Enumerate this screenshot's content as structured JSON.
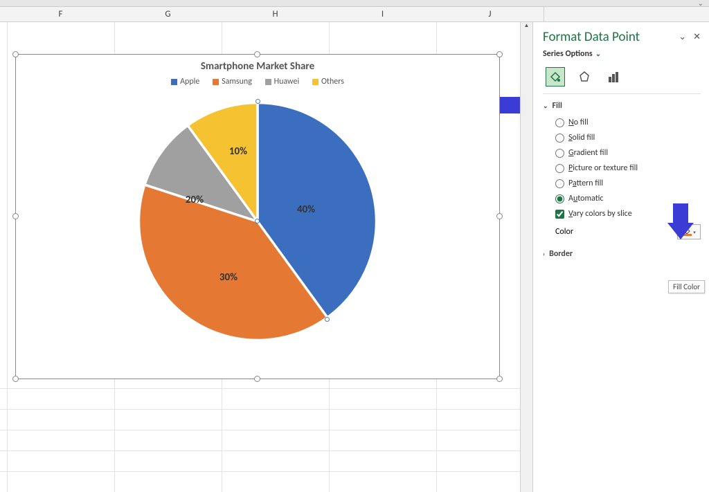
{
  "columns": [
    "F",
    "G",
    "H",
    "I",
    "J"
  ],
  "chart_data": {
    "type": "pie",
    "title": "Smartphone Market Share",
    "categories": [
      "Apple",
      "Samsung",
      "Huawei",
      "Others"
    ],
    "values": [
      40,
      30,
      20,
      10
    ],
    "labels": [
      "40%",
      "30%",
      "20%",
      "10%"
    ],
    "colors": [
      "#3c6ebf",
      "#e57832",
      "#a0a0a0",
      "#f5c231"
    ]
  },
  "pane": {
    "title": "Format Data Point",
    "series_options": "Series Options",
    "sections": {
      "fill": "Fill",
      "border": "Border"
    },
    "fill_options": {
      "no_fill": "No fill",
      "solid_fill": "Solid fill",
      "gradient_fill": "Gradient fill",
      "picture_fill": "Picture or texture fill",
      "pattern_fill": "Pattern fill",
      "automatic": "Automatic",
      "vary_colors": "Vary colors by slice"
    },
    "color_label": "Color",
    "tooltip": "Fill Color"
  }
}
